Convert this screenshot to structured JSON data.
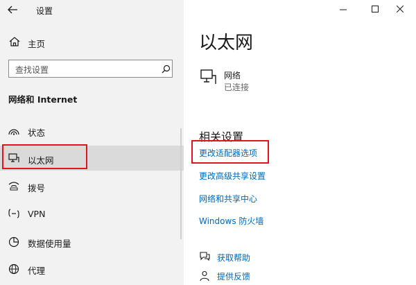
{
  "window": {
    "title": "设置",
    "controls": {
      "minimize": "minimize-icon",
      "maximize": "maximize-icon",
      "close": "close-icon"
    }
  },
  "sidebar": {
    "home_label": "主页",
    "search_placeholder": "查找设置",
    "section_title": "网络和 Internet",
    "items": [
      {
        "label": "状态",
        "icon": "status-icon"
      },
      {
        "label": "以太网",
        "icon": "ethernet-icon",
        "selected": true
      },
      {
        "label": "拨号",
        "icon": "dialup-icon"
      },
      {
        "label": "VPN",
        "icon": "vpn-icon"
      },
      {
        "label": "数据使用量",
        "icon": "data-usage-icon"
      },
      {
        "label": "代理",
        "icon": "proxy-icon"
      }
    ]
  },
  "main": {
    "page_title": "以太网",
    "network": {
      "name": "网络",
      "status": "已连接",
      "icon": "ethernet-network-icon"
    },
    "related_heading": "相关设置",
    "related_links": [
      "更改适配器选项",
      "更改高级共享设置",
      "网络和共享中心",
      "Windows 防火墙"
    ],
    "help": [
      {
        "label": "获取帮助",
        "icon": "help-chat-icon"
      },
      {
        "label": "提供反馈",
        "icon": "feedback-icon"
      }
    ]
  },
  "colors": {
    "link": "#0067b8",
    "highlight": "#e0141e",
    "sidebar_bg": "#f2f2f2",
    "selected_bg": "#dadada"
  }
}
